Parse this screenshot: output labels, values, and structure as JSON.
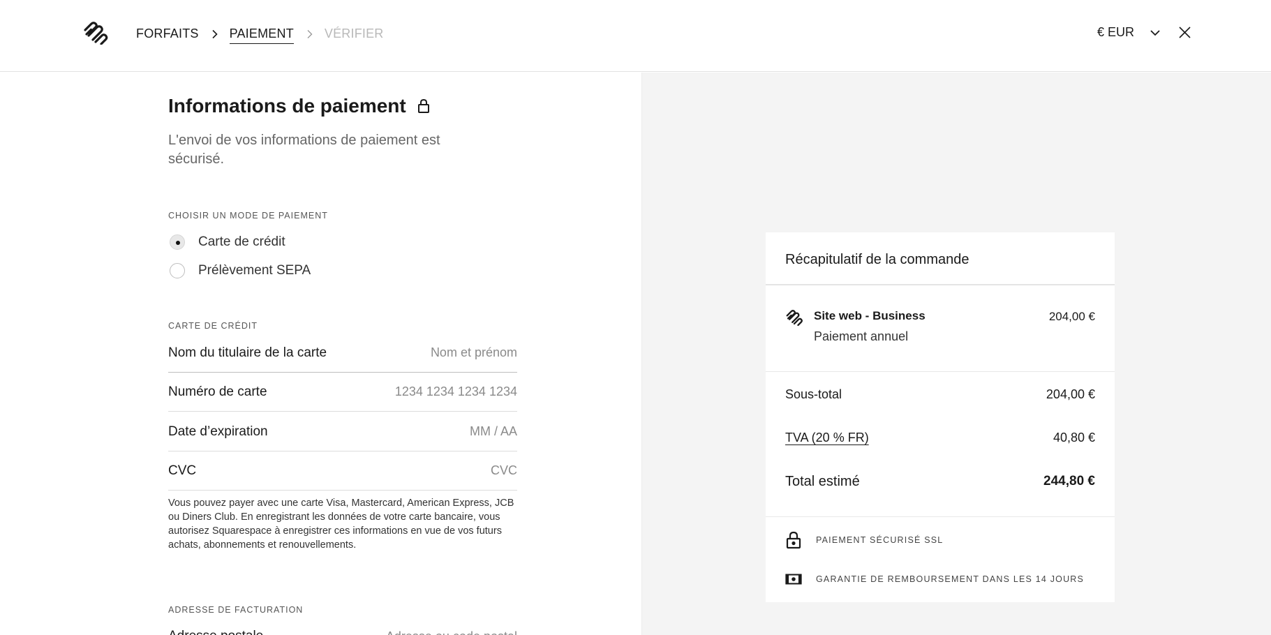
{
  "header": {
    "breadcrumb": [
      "FORFAITS",
      "PAIEMENT",
      "VÉRIFIER"
    ],
    "currency": "€ EUR"
  },
  "payment": {
    "title": "Informations de paiement",
    "subtitle": "L'envoi de vos informations de paiement est sécurisé.",
    "method_label": "CHOISIR UN MODE DE PAIEMENT",
    "methods": [
      "Carte de crédit",
      "Prélèvement SEPA"
    ],
    "selected_method": "Carte de crédit",
    "card_section_label": "CARTE DE CRÉDIT",
    "fields": [
      {
        "label": "Nom du titulaire de la carte",
        "placeholder": "Nom et prénom",
        "value": ""
      },
      {
        "label": "Numéro de carte",
        "placeholder": "1234 1234 1234 1234",
        "value": ""
      },
      {
        "label": "Date d’expiration",
        "placeholder": "MM / AA",
        "value": ""
      },
      {
        "label": "CVC",
        "placeholder": "CVC",
        "value": ""
      }
    ],
    "note": "Vous pouvez payer avec une carte Visa, Mastercard, American Express, JCB ou Diners Club. En enregistrant les données de votre carte bancaire, vous autorisez Squarespace à enregistrer ces informations en vue de vos futurs achats, abonnements et renouvellements.",
    "billing_label": "ADRESSE DE FACTURATION",
    "billing_field_label": "Adresse postale",
    "billing_field_placeholder": "Adresse ou code postal"
  },
  "summary": {
    "title": "Récapitulatif de la commande",
    "item_name": "Site web - Business",
    "item_billing": "Paiement annuel",
    "item_price": "204,00 €",
    "subtotal_label": "Sous-total",
    "subtotal": "204,00 €",
    "tax_label": "TVA (20 % FR)",
    "tax": "40,80 €",
    "total_label": "Total estimé",
    "total": "244,80 €",
    "trust": [
      "PAIEMENT SÉCURISÉ SSL",
      "GARANTIE DE REMBOURSEMENT DANS LES 14 JOURS"
    ]
  },
  "icons": {
    "logo": "squarespace-logo",
    "breadcrumb_separator": "chevron-right-icon",
    "currency_toggle": "chevron-down-icon",
    "close": "close-icon",
    "title_lock": "lock-icon",
    "ssl": "lock-icon",
    "refund": "banknote-icon"
  }
}
